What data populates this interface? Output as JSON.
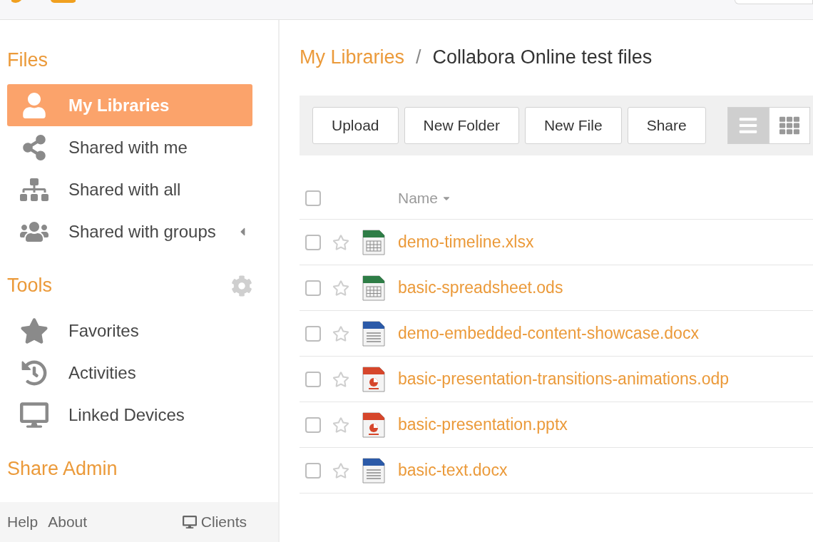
{
  "sidebar": {
    "sections": [
      {
        "heading": "Files",
        "items": [
          {
            "label": "My Libraries",
            "selected": true,
            "expandable": false
          },
          {
            "label": "Shared with me",
            "selected": false,
            "expandable": false
          },
          {
            "label": "Shared with all",
            "selected": false,
            "expandable": false
          },
          {
            "label": "Shared with groups",
            "selected": false,
            "expandable": true
          }
        ]
      },
      {
        "heading": "Tools",
        "items": [
          {
            "label": "Favorites",
            "selected": false,
            "expandable": false
          },
          {
            "label": "Activities",
            "selected": false,
            "expandable": false
          },
          {
            "label": "Linked Devices",
            "selected": false,
            "expandable": false
          }
        ]
      },
      {
        "heading": "Share Admin"
      }
    ],
    "footer": {
      "links": [
        "Help",
        "About"
      ],
      "clients": "Clients"
    }
  },
  "breadcrumb": {
    "parent": "My Libraries",
    "separator": "/",
    "current": "Collabora Online test files"
  },
  "toolbar": {
    "buttons": [
      "Upload",
      "New Folder",
      "New File",
      "Share"
    ],
    "views": [
      {
        "kind": "list",
        "selected": true
      },
      {
        "kind": "grid",
        "selected": false
      }
    ]
  },
  "table": {
    "columns": [
      "Name"
    ],
    "all_checked": false,
    "rows": [
      {
        "name": "demo-timeline.xlsx",
        "kind": "spreadsheet",
        "checked": false,
        "starred": false
      },
      {
        "name": "basic-spreadsheet.ods",
        "kind": "spreadsheet",
        "checked": false,
        "starred": false
      },
      {
        "name": "demo-embedded-content-showcase.docx",
        "kind": "document",
        "checked": false,
        "starred": false
      },
      {
        "name": "basic-presentation-transitions-animations.odp",
        "kind": "presentation",
        "checked": false,
        "starred": false
      },
      {
        "name": "basic-presentation.pptx",
        "kind": "presentation",
        "checked": false,
        "starred": false
      },
      {
        "name": "basic-text.docx",
        "kind": "document",
        "checked": false,
        "starred": false
      }
    ]
  }
}
